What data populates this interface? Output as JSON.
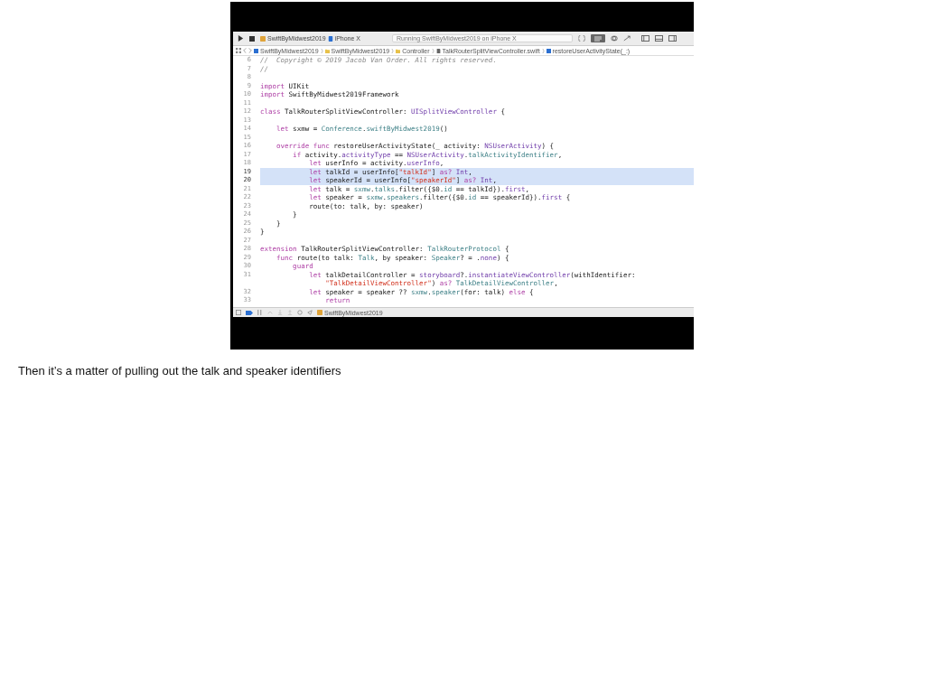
{
  "slide": {
    "toolbar": {
      "scheme": "SwiftByMidwest2019",
      "device": "iPhone X",
      "activity": "Running SwiftByMidwest2019 on iPhone X"
    },
    "jump_bar": [
      "SwiftByMidwest2019",
      "SwiftByMidwest2019",
      "Controller",
      "TalkRouterSplitViewController.swift",
      "restoreUserActivityState(_:)"
    ],
    "code_lines": [
      {
        "number": "6",
        "selected": false,
        "tokens": [
          {
            "t": "//  Copyright © 2019 Jacob Van Order. All rights reserved.",
            "kind": "comment"
          }
        ]
      },
      {
        "number": "7",
        "selected": false,
        "tokens": [
          {
            "t": "//",
            "kind": "comment"
          }
        ]
      },
      {
        "number": "8",
        "selected": false
      },
      {
        "number": "9",
        "selected": false,
        "tokens": [
          {
            "t": "import",
            "kind": "kw"
          },
          {
            "t": " UIKit",
            "kind": "plain"
          }
        ]
      },
      {
        "number": "10",
        "selected": false,
        "tokens": [
          {
            "t": "import",
            "kind": "kw"
          },
          {
            "t": " SwiftByMidwest2019Framework",
            "kind": "plain"
          }
        ]
      },
      {
        "number": "11",
        "selected": false
      },
      {
        "number": "12",
        "selected": false,
        "tokens": [
          {
            "t": "class",
            "kind": "kw"
          },
          {
            "t": " TalkRouterSplitViewController: ",
            "kind": "plain"
          },
          {
            "t": "UISplitViewController",
            "kind": "sys"
          },
          {
            "t": " {",
            "kind": "plain"
          }
        ]
      },
      {
        "number": "13",
        "selected": false
      },
      {
        "number": "14",
        "selected": false,
        "tokens": [
          {
            "t": "    let",
            "kind": "kw"
          },
          {
            "t": " sxmw = ",
            "kind": "plain"
          },
          {
            "t": "Conference",
            "kind": "proj"
          },
          {
            "t": ".",
            "kind": "plain"
          },
          {
            "t": "swiftByMidwest2019",
            "kind": "proj"
          },
          {
            "t": "()",
            "kind": "plain"
          }
        ]
      },
      {
        "number": "15",
        "selected": false
      },
      {
        "number": "16",
        "selected": false,
        "tokens": [
          {
            "t": "    override func",
            "kind": "kw"
          },
          {
            "t": " restoreUserActivityState(_ activity: ",
            "kind": "plain"
          },
          {
            "t": "NSUserActivity",
            "kind": "sys"
          },
          {
            "t": ") {",
            "kind": "plain"
          }
        ]
      },
      {
        "number": "17",
        "selected": false,
        "tokens": [
          {
            "t": "        if",
            "kind": "kw"
          },
          {
            "t": " activity.",
            "kind": "plain"
          },
          {
            "t": "activityType",
            "kind": "sys"
          },
          {
            "t": " == ",
            "kind": "plain"
          },
          {
            "t": "NSUserActivity",
            "kind": "sys"
          },
          {
            "t": ".",
            "kind": "plain"
          },
          {
            "t": "talkActivityIdentifier",
            "kind": "proj"
          },
          {
            "t": ",",
            "kind": "plain"
          }
        ]
      },
      {
        "number": "18",
        "selected": false,
        "tokens": [
          {
            "t": "            let",
            "kind": "kw"
          },
          {
            "t": " userInfo = activity.",
            "kind": "plain"
          },
          {
            "t": "userInfo",
            "kind": "sys"
          },
          {
            "t": ",",
            "kind": "plain"
          }
        ]
      },
      {
        "number": "19",
        "selected": true,
        "tokens": [
          {
            "t": "            let",
            "kind": "kw"
          },
          {
            "t": " talkId = userInfo[",
            "kind": "plain"
          },
          {
            "t": "\"talkId\"",
            "kind": "str"
          },
          {
            "t": "] ",
            "kind": "plain"
          },
          {
            "t": "as?",
            "kind": "kw"
          },
          {
            "t": " Int",
            "kind": "sys"
          },
          {
            "t": ",",
            "kind": "plain"
          }
        ]
      },
      {
        "number": "20",
        "selected": true,
        "tokens": [
          {
            "t": "            let",
            "kind": "kw"
          },
          {
            "t": " speakerId = userInfo[",
            "kind": "plain"
          },
          {
            "t": "\"speakerId\"",
            "kind": "str"
          },
          {
            "t": "] ",
            "kind": "plain"
          },
          {
            "t": "as?",
            "kind": "kw"
          },
          {
            "t": " Int",
            "kind": "sys"
          },
          {
            "t": ",",
            "kind": "plain"
          }
        ]
      },
      {
        "number": "21",
        "selected": false,
        "tokens": [
          {
            "t": "            let",
            "kind": "kw"
          },
          {
            "t": " talk = ",
            "kind": "plain"
          },
          {
            "t": "sxmw",
            "kind": "proj"
          },
          {
            "t": ".",
            "kind": "plain"
          },
          {
            "t": "talks",
            "kind": "proj"
          },
          {
            "t": ".filter({$0.",
            "kind": "plain"
          },
          {
            "t": "id",
            "kind": "proj"
          },
          {
            "t": " == talkId}).",
            "kind": "plain"
          },
          {
            "t": "first",
            "kind": "sys"
          },
          {
            "t": ",",
            "kind": "plain"
          }
        ]
      },
      {
        "number": "22",
        "selected": false,
        "tokens": [
          {
            "t": "            let",
            "kind": "kw"
          },
          {
            "t": " speaker = ",
            "kind": "plain"
          },
          {
            "t": "sxmw",
            "kind": "proj"
          },
          {
            "t": ".",
            "kind": "plain"
          },
          {
            "t": "speakers",
            "kind": "proj"
          },
          {
            "t": ".filter({$0.",
            "kind": "plain"
          },
          {
            "t": "id",
            "kind": "proj"
          },
          {
            "t": " == speakerId}).",
            "kind": "plain"
          },
          {
            "t": "first",
            "kind": "sys"
          },
          {
            "t": " {",
            "kind": "plain"
          }
        ]
      },
      {
        "number": "23",
        "selected": false,
        "tokens": [
          {
            "t": "            route(to: talk, by: speaker)",
            "kind": "plain"
          }
        ]
      },
      {
        "number": "24",
        "selected": false,
        "tokens": [
          {
            "t": "        }",
            "kind": "plain"
          }
        ]
      },
      {
        "number": "25",
        "selected": false,
        "tokens": [
          {
            "t": "    }",
            "kind": "plain"
          }
        ]
      },
      {
        "number": "26",
        "selected": false,
        "tokens": [
          {
            "t": "}",
            "kind": "plain"
          }
        ]
      },
      {
        "number": "27",
        "selected": false
      },
      {
        "number": "28",
        "selected": false,
        "tokens": [
          {
            "t": "extension",
            "kind": "kw"
          },
          {
            "t": " TalkRouterSplitViewController: ",
            "kind": "plain"
          },
          {
            "t": "TalkRouterProtocol",
            "kind": "proj"
          },
          {
            "t": " {",
            "kind": "plain"
          }
        ]
      },
      {
        "number": "29",
        "selected": false,
        "tokens": [
          {
            "t": "    func",
            "kind": "kw"
          },
          {
            "t": " route(to talk: ",
            "kind": "plain"
          },
          {
            "t": "Talk",
            "kind": "proj"
          },
          {
            "t": ", by speaker: ",
            "kind": "plain"
          },
          {
            "t": "Speaker",
            "kind": "proj"
          },
          {
            "t": "? = .",
            "kind": "plain"
          },
          {
            "t": "none",
            "kind": "sys"
          },
          {
            "t": ") {",
            "kind": "plain"
          }
        ]
      },
      {
        "number": "30",
        "selected": false,
        "tokens": [
          {
            "t": "        guard",
            "kind": "kw"
          }
        ]
      },
      {
        "number": "31",
        "selected": false,
        "tokens": [
          {
            "t": "            let",
            "kind": "kw"
          },
          {
            "t": " talkDetailController = ",
            "kind": "plain"
          },
          {
            "t": "storyboard",
            "kind": "sys"
          },
          {
            "t": "?.",
            "kind": "plain"
          },
          {
            "t": "instantiateViewController",
            "kind": "sys"
          },
          {
            "t": "(withIdentifier:",
            "kind": "plain"
          }
        ]
      },
      {
        "selected": false,
        "tokens": [
          {
            "t": "                \"TalkDetailViewController\"",
            "kind": "str"
          },
          {
            "t": ") ",
            "kind": "plain"
          },
          {
            "t": "as?",
            "kind": "kw"
          },
          {
            "t": " TalkDetailViewController",
            "kind": "proj"
          },
          {
            "t": ",",
            "kind": "plain"
          }
        ]
      },
      {
        "number": "32",
        "selected": false,
        "tokens": [
          {
            "t": "            let",
            "kind": "kw"
          },
          {
            "t": " speaker = speaker ?? ",
            "kind": "plain"
          },
          {
            "t": "sxmw",
            "kind": "proj"
          },
          {
            "t": ".",
            "kind": "plain"
          },
          {
            "t": "speaker",
            "kind": "proj"
          },
          {
            "t": "(for: talk) ",
            "kind": "plain"
          },
          {
            "t": "else",
            "kind": "kw"
          },
          {
            "t": " {",
            "kind": "plain"
          }
        ]
      },
      {
        "number": "33",
        "selected": false,
        "tokens": [
          {
            "t": "                return",
            "kind": "kw"
          }
        ]
      }
    ],
    "debug_bar": {
      "target": "SwiftByMidwest2019"
    }
  },
  "notes": "Then it’s a matter of pulling out the talk and speaker identifiers"
}
